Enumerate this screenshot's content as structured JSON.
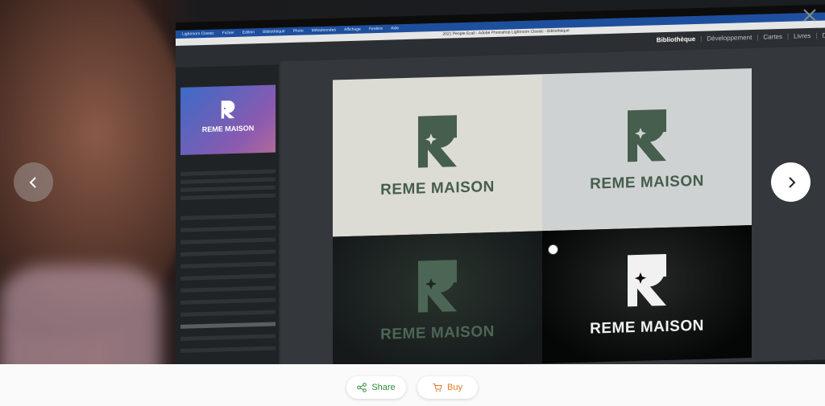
{
  "viewer": {
    "lightroom": {
      "menu": [
        "Lightroom Classic",
        "Fichier",
        "Edition",
        "Bibliothèque",
        "Photo",
        "Métadonnées",
        "Affichage",
        "Fenêtre",
        "Aide"
      ],
      "window_title": "2021 People Ecall - Adobe Photoshop Lightroom Classic - Bibliothèque",
      "modules": [
        "Bibliothèque",
        "Développement",
        "Cartes",
        "Livres",
        "Di"
      ],
      "active_module": "Bibliothèque",
      "navigator_brand": "REME MAISON"
    },
    "tiles": [
      {
        "label": "REME MAISON",
        "bg": "#dddcd4",
        "fg": "#465e4d"
      },
      {
        "label": "REME MAISON",
        "bg": "#cfd2d3",
        "fg": "#465e4d"
      },
      {
        "label": "REME MAISON",
        "bg": "#1f2724",
        "fg": "#4c6655"
      },
      {
        "label": "REME MAISON",
        "bg": "#0d0f0f",
        "fg": "#f1f1f1"
      }
    ]
  },
  "controls": {
    "prev_icon": "chevron-left-icon",
    "next_icon": "chevron-right-icon",
    "close_icon": "close-icon"
  },
  "actions": {
    "share_label": "Share",
    "share_color": "#2e8b3e",
    "buy_label": "Buy",
    "buy_color": "#e07b2a"
  }
}
